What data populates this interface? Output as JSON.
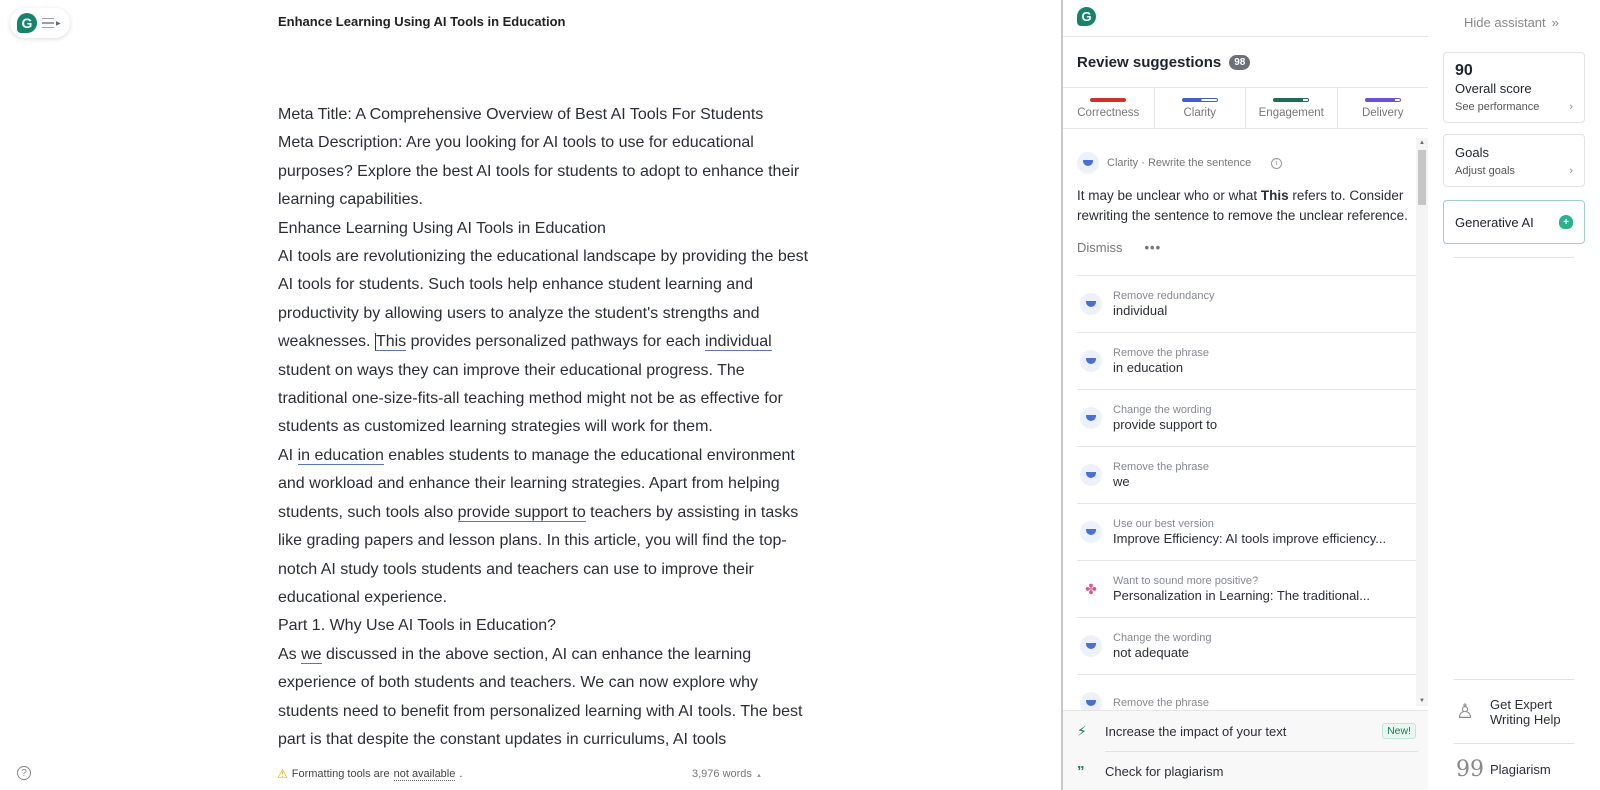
{
  "document": {
    "title": "Enhance Learning Using AI Tools in Education",
    "paragraphs": {
      "p1": "Meta Title: A Comprehensive Overview of Best AI Tools For Students",
      "p2": "Meta Description: Are you looking for AI tools to use for educational purposes? Explore the best AI tools for students to adopt to enhance their learning capabilities.",
      "p3": "Enhance Learning Using AI Tools in Education",
      "p4a": "AI tools are revolutionizing the educational landscape by providing the best AI tools for students. Such tools help enhance student learning and productivity by allowing users to analyze the student's strengths and weaknesses. ",
      "p4_flag1": "This",
      "p4b": " provides personalized pathways for each ",
      "p4_flag2": "individual",
      "p4c": " student on ways they can improve their educational progress. The traditional one-size-fits-all teaching method might not be as effective for students as customized learning strategies will work for them.",
      "p5a": "AI ",
      "p5_flag1": "in education",
      "p5b": " enables students to manage the educational environment and workload and enhance their learning strategies. Apart from helping students, such tools also ",
      "p5_flag2": "provide support to",
      "p5c": " teachers by assisting in tasks like grading papers and lesson plans. In this article, you will find the top-notch AI study tools students and teachers can use to improve their educational experience.",
      "p6": "Part 1. Why Use AI Tools in Education?",
      "p7a": "As ",
      "p7_flag1": "we",
      "p7b": " discussed in the above section, AI can enhance the learning experience of both students and teachers. We can now explore why students need to benefit from personalized learning with AI tools. The best part is that despite the constant updates in curriculums, AI tools"
    }
  },
  "status_bar": {
    "warning_prefix": "Formatting tools are ",
    "warning_link": "not available",
    "warning_suffix": ".",
    "word_count": "3,976 words"
  },
  "assistant": {
    "review_title": "Review suggestions",
    "suggestion_count": "98",
    "tabs": [
      {
        "label": "Correctness",
        "color": "#d0312d",
        "progress": 1.0
      },
      {
        "label": "Clarity",
        "color": "#3f5fd0",
        "progress": 0.55
      },
      {
        "label": "Engagement",
        "color": "#1f6b55",
        "progress": 0.85
      },
      {
        "label": "Delivery",
        "color": "#6a4fd8",
        "progress": 0.85
      }
    ],
    "active_card": {
      "category": "Clarity · Rewrite the sentence",
      "text_before": "It may be unclear who or what ",
      "text_bold": "This",
      "text_after": " refers to. Consider rewriting the sentence to remove the unclear reference.",
      "dismiss_label": "Dismiss",
      "more_label": "•••"
    },
    "suggestions": [
      {
        "title": "Remove redundancy",
        "value": "individual",
        "icon": "clarity-icon"
      },
      {
        "title": "Remove the phrase",
        "value": "in education",
        "icon": "clarity-icon"
      },
      {
        "title": "Change the wording",
        "value": "provide support to",
        "icon": "clarity-icon"
      },
      {
        "title": "Remove the phrase",
        "value": "we",
        "icon": "clarity-icon"
      },
      {
        "title": "Use our best version",
        "value": "Improve Efficiency: AI tools improve efficiency...",
        "icon": "clarity-icon"
      },
      {
        "title": "Want to sound more positive?",
        "value": "Personalization in Learning: The traditional...",
        "icon": "tone-icon"
      },
      {
        "title": "Change the wording",
        "value": "not adequate",
        "icon": "clarity-icon"
      },
      {
        "title": "Remove the phrase",
        "value": "",
        "icon": "clarity-icon"
      }
    ],
    "bottom": {
      "impact_label": "Increase the impact of your text",
      "new_badge": "New!",
      "plagiarism_label": "Check for plagiarism"
    }
  },
  "right_column": {
    "hide_label": "Hide assistant",
    "score": "90",
    "score_label": "Overall score",
    "score_link": "See performance",
    "goals_label": "Goals",
    "goals_link": "Adjust goals",
    "gen_ai_label": "Generative AI",
    "expert_label_1": "Get Expert",
    "expert_label_2": "Writing Help",
    "plagiarism_label": "Plagiarism"
  }
}
